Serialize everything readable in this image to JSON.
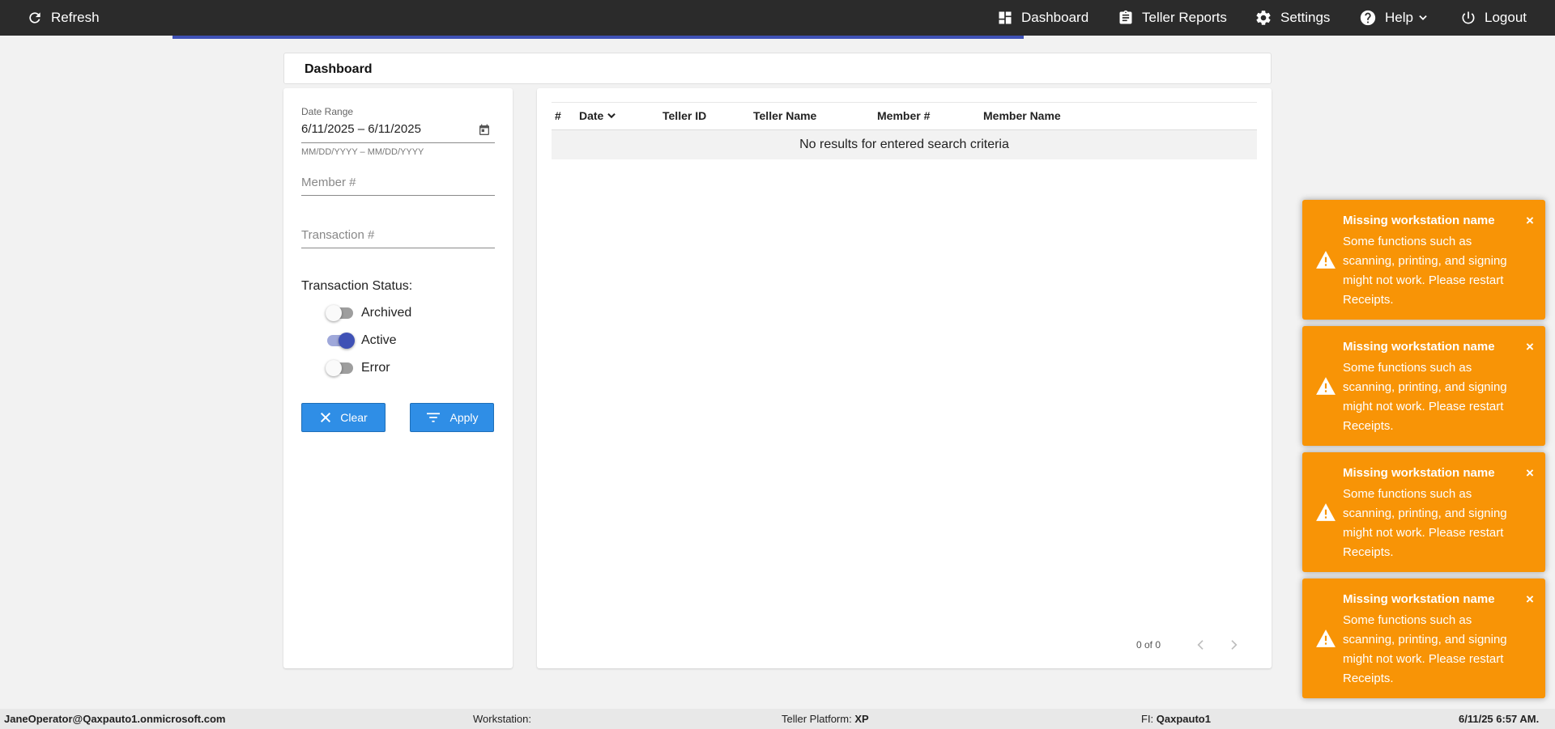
{
  "topbar": {
    "refresh_label": "Refresh",
    "nav": {
      "dashboard": "Dashboard",
      "teller_reports": "Teller Reports",
      "settings": "Settings",
      "help": "Help",
      "logout": "Logout"
    },
    "icons": {
      "refresh": "refresh-icon",
      "dashboard": "dashboard-icon",
      "teller_reports": "clipboard-icon",
      "settings": "gear-icon",
      "help": "help-icon",
      "logout": "power-icon"
    }
  },
  "page": {
    "title": "Dashboard"
  },
  "filters": {
    "date_range_label": "Date Range",
    "date_range_value": "6/11/2025 – 6/11/2025",
    "date_range_hint": "MM/DD/YYYY – MM/DD/YYYY",
    "member_placeholder": "Member #",
    "transaction_placeholder": "Transaction #",
    "status_title": "Transaction Status:",
    "statuses": [
      {
        "label": "Archived",
        "on": false
      },
      {
        "label": "Active",
        "on": true
      },
      {
        "label": "Error",
        "on": false
      }
    ],
    "clear_label": "Clear",
    "apply_label": "Apply"
  },
  "results": {
    "columns": [
      "#",
      "Date",
      "Teller ID",
      "Teller Name",
      "Member #",
      "Member Name"
    ],
    "empty_message": "No results for entered search criteria",
    "pager_text": "0 of 0"
  },
  "toasts": [
    {
      "title": "Missing workstation name",
      "message": "Some functions such as scanning, printing, and signing might not work. Please restart Receipts."
    },
    {
      "title": "Missing workstation name",
      "message": "Some functions such as scanning, printing, and signing might not work. Please restart Receipts."
    },
    {
      "title": "Missing workstation name",
      "message": "Some functions such as scanning, printing, and signing might not work. Please restart Receipts."
    },
    {
      "title": "Missing workstation name",
      "message": "Some functions such as scanning, printing, and signing might not work. Please restart Receipts."
    }
  ],
  "toast_close": "×",
  "footer": {
    "user": "JaneOperator@Qaxpauto1.onmicrosoft.com",
    "workstation_label": "Workstation:",
    "workstation_value": "",
    "platform_label": "Teller Platform:",
    "platform_value": "XP",
    "fi_label": "FI:",
    "fi_value": "Qaxpauto1",
    "datetime": "6/11/25 6:57 AM."
  },
  "colors": {
    "topbar": "#2b2b2b",
    "accent": "#3f51b5",
    "button": "#2f8ee6",
    "toast": "#f89406"
  }
}
